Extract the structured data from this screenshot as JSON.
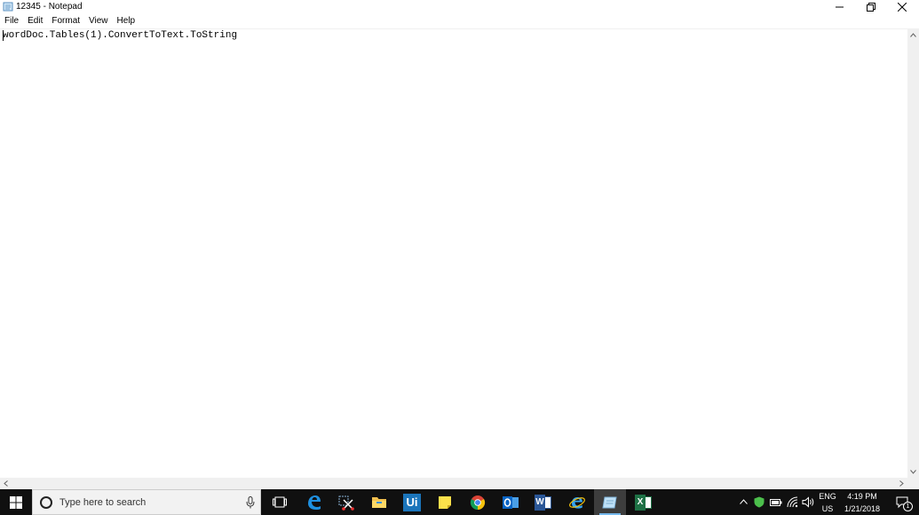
{
  "window": {
    "title": "12345 - Notepad"
  },
  "menu": {
    "items": [
      "File",
      "Edit",
      "Format",
      "View",
      "Help"
    ]
  },
  "editor": {
    "content": "wordDoc.Tables(1).ConvertToText.ToString"
  },
  "taskbar": {
    "search_placeholder": "Type here to search",
    "apps": [
      {
        "name": "task-view-icon"
      },
      {
        "name": "edge-icon"
      },
      {
        "name": "snipping-tool-icon"
      },
      {
        "name": "file-explorer-icon"
      },
      {
        "name": "uipath-icon",
        "label": "Ui"
      },
      {
        "name": "sticky-notes-icon"
      },
      {
        "name": "chrome-icon"
      },
      {
        "name": "outlook-icon"
      },
      {
        "name": "word-icon",
        "label": "W"
      },
      {
        "name": "internet-explorer-icon"
      },
      {
        "name": "notepad-icon"
      },
      {
        "name": "excel-icon",
        "label": "X"
      }
    ],
    "tray": {
      "language": "ENG",
      "region": "US",
      "time": "4:19 PM",
      "date": "1/21/2018",
      "notification_count": "1"
    }
  }
}
